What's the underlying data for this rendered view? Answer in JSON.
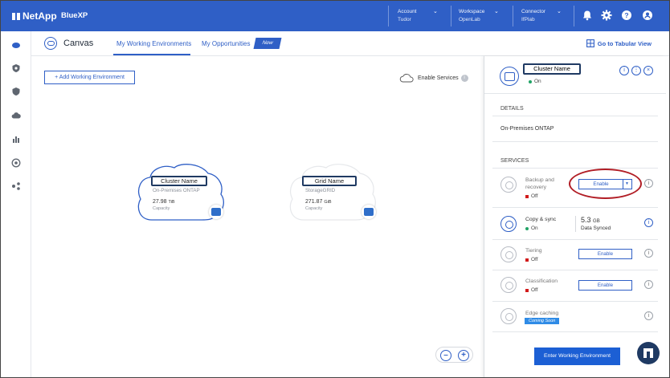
{
  "topbar": {
    "brand": "NetApp",
    "product": "BlueXP",
    "account": {
      "label": "Account",
      "value": "Tudor"
    },
    "workspace": {
      "label": "Workspace",
      "value": "OpenLab"
    },
    "connector": {
      "label": "Connector",
      "value": "IfPlab"
    },
    "icons": [
      "bell-icon",
      "gear-icon",
      "help-icon",
      "user-icon"
    ]
  },
  "subheader": {
    "title": "Canvas",
    "tabs": [
      {
        "label": "My Working Environments",
        "active": true
      },
      {
        "label": "My Opportunities",
        "active": false
      }
    ],
    "new_badge": "New",
    "tabular_view": "Go to Tabular View"
  },
  "canvas": {
    "add_button": "+ Add Working Environment",
    "enable_services": "Enable Services",
    "environments": [
      {
        "name": "Cluster Name",
        "type": "On-Premises ONTAP",
        "capacity_value": "27.98",
        "capacity_unit": "TiB",
        "capacity_label": "Capacity"
      },
      {
        "name": "Grid Name",
        "type": "StorageGRID",
        "capacity_value": "271.87",
        "capacity_unit": "GiB",
        "capacity_label": "Capacity"
      }
    ],
    "zoom_out": "–",
    "zoom_in": "+"
  },
  "panel": {
    "name": "Cluster Name",
    "status": "On",
    "details_title": "DETAILS",
    "details_value": "On-Premises ONTAP",
    "services_title": "SERVICES",
    "services": [
      {
        "name_line1": "Backup and",
        "name_line2": "recovery",
        "status": "Off",
        "action": "Enable"
      },
      {
        "name_line1": "Copy & sync",
        "name_line2": "",
        "status": "On",
        "value": "5.3",
        "value_unit": "GB",
        "value_label": "Data Synced"
      },
      {
        "name_line1": "Tiering",
        "name_line2": "",
        "status": "Off",
        "action": "Enable"
      },
      {
        "name_line1": "Classification",
        "name_line2": "",
        "status": "Off",
        "action": "Enable"
      },
      {
        "name_line1": "Edge caching",
        "name_line2": "",
        "badge": "Coming Soon"
      }
    ],
    "enter_button": "Enter Working Environment"
  },
  "colors": {
    "brand_blue": "#2f5fc6",
    "annotation_red": "#b11d25",
    "dark_navy": "#1f3a63"
  }
}
